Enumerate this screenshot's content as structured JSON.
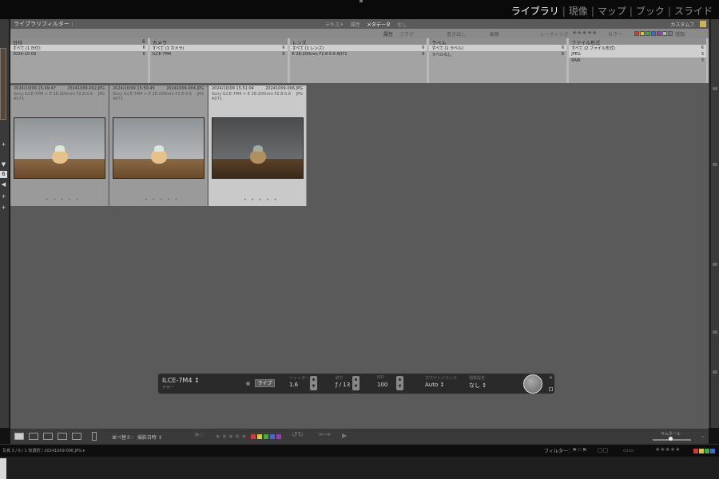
{
  "modules": [
    "ライブラリ",
    "現像",
    "マップ",
    "ブック",
    "スライド"
  ],
  "filter_bar": {
    "title": "ライブラリフィルター :",
    "tabs": [
      "テキスト",
      "属性",
      "メタデータ",
      "なし"
    ],
    "active_tab": "メタデータ",
    "preset": "カスタムフ",
    "attr": {
      "attribute": "属性",
      "flag": "フラグ",
      "master": "書き出し",
      "edit": "編集",
      "rating": "レーティング",
      "rating_stars": "★★★★★",
      "color": "カラー",
      "kind": "種類"
    },
    "attr_colors": [
      "#d23a3a",
      "#e0c23a",
      "#3ab23a",
      "#3a6ad2",
      "#9a3ab2",
      "#b5b5b5",
      "#7a7a7a"
    ],
    "columns": [
      {
        "header": "日付",
        "count": "6",
        "rows": [
          {
            "label": "すべて (1 日付)",
            "count": "6"
          },
          {
            "label": "2024-10-09",
            "count": "6"
          }
        ]
      },
      {
        "header": "カメラ",
        "count": "",
        "rows": [
          {
            "label": "すべて (1 カメラ)",
            "count": "6"
          },
          {
            "label": "ILCE-7M4",
            "count": "6"
          }
        ]
      },
      {
        "header": "レンズ",
        "count": "",
        "rows": [
          {
            "label": "すべて (1 レンズ)",
            "count": "6"
          },
          {
            "label": "E 28-200mm F2.8-5.6 A071",
            "count": "6"
          }
        ]
      },
      {
        "header": "ラベル",
        "count": "",
        "rows": [
          {
            "label": "すべて (1 ラベル)",
            "count": "6"
          },
          {
            "label": "ラベルなし",
            "count": "6"
          }
        ]
      },
      {
        "header": "ファイル形式",
        "count": "",
        "rows": [
          {
            "label": "すべて (2 ファイル形式)",
            "count": "6"
          },
          {
            "label": "JPEG",
            "count": "3"
          },
          {
            "label": "RAW",
            "count": "3"
          }
        ]
      }
    ]
  },
  "grid": {
    "cells": [
      {
        "datetime": "2024/10/09 15:49:47",
        "file": "20241009-002.JPG",
        "camera": "Sony ILCE-7M4 + E 28-200mm F2.8-5.6 A071",
        "format": "JPG",
        "dark": false
      },
      {
        "datetime": "2024/10/09 15:50:45",
        "file": "20241009-004.JPG",
        "camera": "Sony ILCE-7M4 + E 28-200mm F2.8-5.6 A071",
        "format": "JPG",
        "dark": false
      },
      {
        "datetime": "2024/10/09 15:51:04",
        "file": "20241009-006.JPG",
        "camera": "Sony ILCE-7M4 + E 28-200mm F2.8-5.6 A071",
        "format": "JPG",
        "dark": true
      }
    ],
    "dots": "• • • • •"
  },
  "tether": {
    "camera": "ILCE-7M4 ↕",
    "mode": "テザー",
    "live_label": "ライブ",
    "shutter_label": "シャッター",
    "shutter_val": "1.6",
    "aperture_label": "絞り",
    "aperture_val": "ƒ / 13",
    "iso_label": "ISO",
    "iso_val": "100",
    "wb_label": "ホワイトバランス",
    "wb_val": "Auto ↕",
    "preset_label": "現像設定",
    "preset_val": "なし ↕",
    "close": "×"
  },
  "toolbar": {
    "sort_label": "並べ替え： 撮影日時 ↕",
    "stars": "★★★★★",
    "colors": [
      "#d23a3a",
      "#e0c23a",
      "#3ab23a",
      "#3a6ad2",
      "#9a3ab2"
    ],
    "thumbs_label": "サムネール"
  },
  "status": {
    "photos": "写真 3 / 6 / 1 枚選択 / 20241009-006.JPG ▾",
    "filter_label": "フィルター：",
    "stars": "★★★★★",
    "colors": [
      "#d23a3a",
      "#e0c23a",
      "#3ab23a",
      "#3a6ad2"
    ]
  }
}
